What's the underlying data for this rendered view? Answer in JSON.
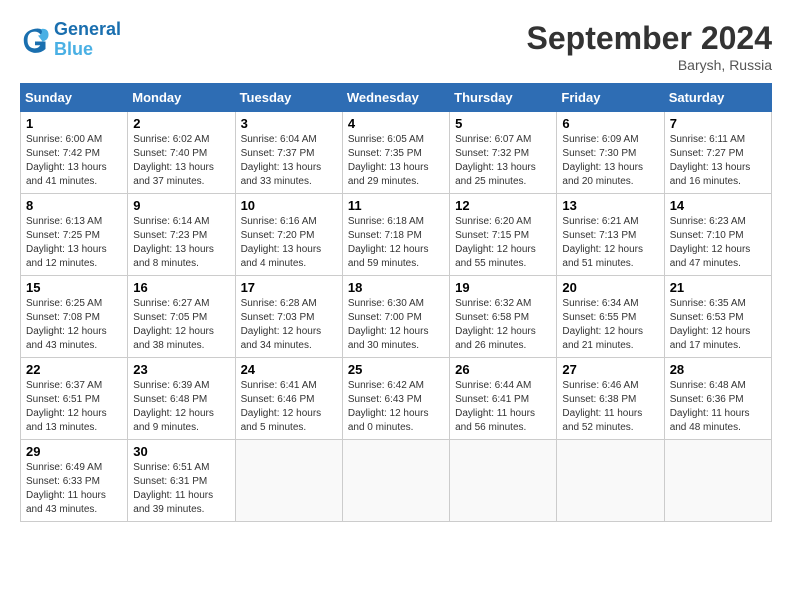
{
  "header": {
    "logo_line1": "General",
    "logo_line2": "Blue",
    "month": "September 2024",
    "location": "Barysh, Russia"
  },
  "weekdays": [
    "Sunday",
    "Monday",
    "Tuesday",
    "Wednesday",
    "Thursday",
    "Friday",
    "Saturday"
  ],
  "weeks": [
    [
      {
        "day": "1",
        "sunrise": "Sunrise: 6:00 AM",
        "sunset": "Sunset: 7:42 PM",
        "daylight": "Daylight: 13 hours and 41 minutes."
      },
      {
        "day": "2",
        "sunrise": "Sunrise: 6:02 AM",
        "sunset": "Sunset: 7:40 PM",
        "daylight": "Daylight: 13 hours and 37 minutes."
      },
      {
        "day": "3",
        "sunrise": "Sunrise: 6:04 AM",
        "sunset": "Sunset: 7:37 PM",
        "daylight": "Daylight: 13 hours and 33 minutes."
      },
      {
        "day": "4",
        "sunrise": "Sunrise: 6:05 AM",
        "sunset": "Sunset: 7:35 PM",
        "daylight": "Daylight: 13 hours and 29 minutes."
      },
      {
        "day": "5",
        "sunrise": "Sunrise: 6:07 AM",
        "sunset": "Sunset: 7:32 PM",
        "daylight": "Daylight: 13 hours and 25 minutes."
      },
      {
        "day": "6",
        "sunrise": "Sunrise: 6:09 AM",
        "sunset": "Sunset: 7:30 PM",
        "daylight": "Daylight: 13 hours and 20 minutes."
      },
      {
        "day": "7",
        "sunrise": "Sunrise: 6:11 AM",
        "sunset": "Sunset: 7:27 PM",
        "daylight": "Daylight: 13 hours and 16 minutes."
      }
    ],
    [
      {
        "day": "8",
        "sunrise": "Sunrise: 6:13 AM",
        "sunset": "Sunset: 7:25 PM",
        "daylight": "Daylight: 13 hours and 12 minutes."
      },
      {
        "day": "9",
        "sunrise": "Sunrise: 6:14 AM",
        "sunset": "Sunset: 7:23 PM",
        "daylight": "Daylight: 13 hours and 8 minutes."
      },
      {
        "day": "10",
        "sunrise": "Sunrise: 6:16 AM",
        "sunset": "Sunset: 7:20 PM",
        "daylight": "Daylight: 13 hours and 4 minutes."
      },
      {
        "day": "11",
        "sunrise": "Sunrise: 6:18 AM",
        "sunset": "Sunset: 7:18 PM",
        "daylight": "Daylight: 12 hours and 59 minutes."
      },
      {
        "day": "12",
        "sunrise": "Sunrise: 6:20 AM",
        "sunset": "Sunset: 7:15 PM",
        "daylight": "Daylight: 12 hours and 55 minutes."
      },
      {
        "day": "13",
        "sunrise": "Sunrise: 6:21 AM",
        "sunset": "Sunset: 7:13 PM",
        "daylight": "Daylight: 12 hours and 51 minutes."
      },
      {
        "day": "14",
        "sunrise": "Sunrise: 6:23 AM",
        "sunset": "Sunset: 7:10 PM",
        "daylight": "Daylight: 12 hours and 47 minutes."
      }
    ],
    [
      {
        "day": "15",
        "sunrise": "Sunrise: 6:25 AM",
        "sunset": "Sunset: 7:08 PM",
        "daylight": "Daylight: 12 hours and 43 minutes."
      },
      {
        "day": "16",
        "sunrise": "Sunrise: 6:27 AM",
        "sunset": "Sunset: 7:05 PM",
        "daylight": "Daylight: 12 hours and 38 minutes."
      },
      {
        "day": "17",
        "sunrise": "Sunrise: 6:28 AM",
        "sunset": "Sunset: 7:03 PM",
        "daylight": "Daylight: 12 hours and 34 minutes."
      },
      {
        "day": "18",
        "sunrise": "Sunrise: 6:30 AM",
        "sunset": "Sunset: 7:00 PM",
        "daylight": "Daylight: 12 hours and 30 minutes."
      },
      {
        "day": "19",
        "sunrise": "Sunrise: 6:32 AM",
        "sunset": "Sunset: 6:58 PM",
        "daylight": "Daylight: 12 hours and 26 minutes."
      },
      {
        "day": "20",
        "sunrise": "Sunrise: 6:34 AM",
        "sunset": "Sunset: 6:55 PM",
        "daylight": "Daylight: 12 hours and 21 minutes."
      },
      {
        "day": "21",
        "sunrise": "Sunrise: 6:35 AM",
        "sunset": "Sunset: 6:53 PM",
        "daylight": "Daylight: 12 hours and 17 minutes."
      }
    ],
    [
      {
        "day": "22",
        "sunrise": "Sunrise: 6:37 AM",
        "sunset": "Sunset: 6:51 PM",
        "daylight": "Daylight: 12 hours and 13 minutes."
      },
      {
        "day": "23",
        "sunrise": "Sunrise: 6:39 AM",
        "sunset": "Sunset: 6:48 PM",
        "daylight": "Daylight: 12 hours and 9 minutes."
      },
      {
        "day": "24",
        "sunrise": "Sunrise: 6:41 AM",
        "sunset": "Sunset: 6:46 PM",
        "daylight": "Daylight: 12 hours and 5 minutes."
      },
      {
        "day": "25",
        "sunrise": "Sunrise: 6:42 AM",
        "sunset": "Sunset: 6:43 PM",
        "daylight": "Daylight: 12 hours and 0 minutes."
      },
      {
        "day": "26",
        "sunrise": "Sunrise: 6:44 AM",
        "sunset": "Sunset: 6:41 PM",
        "daylight": "Daylight: 11 hours and 56 minutes."
      },
      {
        "day": "27",
        "sunrise": "Sunrise: 6:46 AM",
        "sunset": "Sunset: 6:38 PM",
        "daylight": "Daylight: 11 hours and 52 minutes."
      },
      {
        "day": "28",
        "sunrise": "Sunrise: 6:48 AM",
        "sunset": "Sunset: 6:36 PM",
        "daylight": "Daylight: 11 hours and 48 minutes."
      }
    ],
    [
      {
        "day": "29",
        "sunrise": "Sunrise: 6:49 AM",
        "sunset": "Sunset: 6:33 PM",
        "daylight": "Daylight: 11 hours and 43 minutes."
      },
      {
        "day": "30",
        "sunrise": "Sunrise: 6:51 AM",
        "sunset": "Sunset: 6:31 PM",
        "daylight": "Daylight: 11 hours and 39 minutes."
      },
      null,
      null,
      null,
      null,
      null
    ]
  ]
}
